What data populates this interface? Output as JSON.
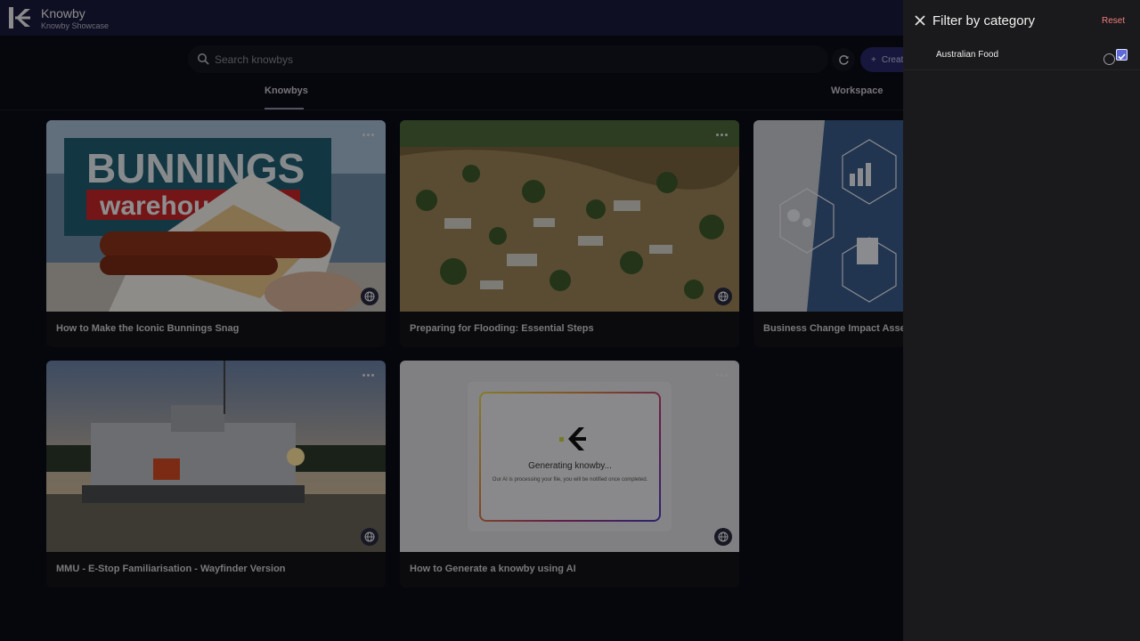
{
  "header": {
    "title": "Knowby",
    "subtitle": "Knowby Showcase"
  },
  "search": {
    "placeholder": "Search knowbys"
  },
  "toolbar": {
    "create_label": "Create"
  },
  "tabs": [
    {
      "label": "Knowbys",
      "active": true
    },
    {
      "label": "Workspace",
      "active": false
    }
  ],
  "cards": [
    {
      "title": "How to Make the Iconic Bunnings Snag",
      "image": "bunnings-sausage-photo"
    },
    {
      "title": "Preparing for Flooding: Essential Steps",
      "image": "flooded-town-aerial-photo"
    },
    {
      "title": "Business Change Impact Assessment",
      "image": "business-icons-hexagon-photo"
    },
    {
      "title": "MMU - E-Stop Familiarisation - Wayfinder Version",
      "image": "mining-machine-sunset-photo"
    },
    {
      "title": "How to Generate a knowby using AI",
      "image": "generating-placeholder"
    }
  ],
  "generating": {
    "title": "Generating knowby...",
    "text": "Our AI is processing your file, you will be notified once completed."
  },
  "filter_panel": {
    "title": "Filter by category",
    "reset_label": "Reset",
    "items": [
      {
        "label": "Australian Food",
        "checked": true
      }
    ]
  },
  "colors": {
    "topbar": "#1b1b3e",
    "accent": "#5f6ad8",
    "reset": "#f07d7d",
    "panel": "#1a1a1c"
  }
}
